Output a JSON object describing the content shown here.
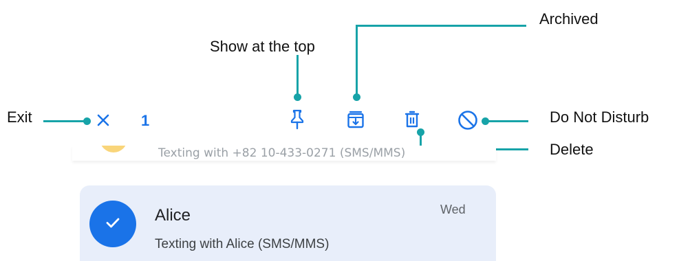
{
  "callouts": {
    "archived": "Archived",
    "show_at_top": "Show at the top",
    "exit": "Exit",
    "do_not_disturb": "Do Not Disturb",
    "delete": "Delete"
  },
  "toolbar": {
    "selected_count": "1",
    "icons": [
      "close-icon",
      "pin-icon",
      "archive-icon",
      "trash-icon",
      "block-icon"
    ]
  },
  "conversations": [
    {
      "preview": "Texting with +82 10-433-0271 (SMS/MMS)"
    },
    {
      "name": "Alice",
      "preview": "Texting with Alice (SMS/MMS)",
      "date": "Wed",
      "selected": true
    }
  ],
  "colors": {
    "accent": "#1a73e8",
    "callout_line": "#17a3a8",
    "selected_row_bg": "#e8eefa"
  }
}
